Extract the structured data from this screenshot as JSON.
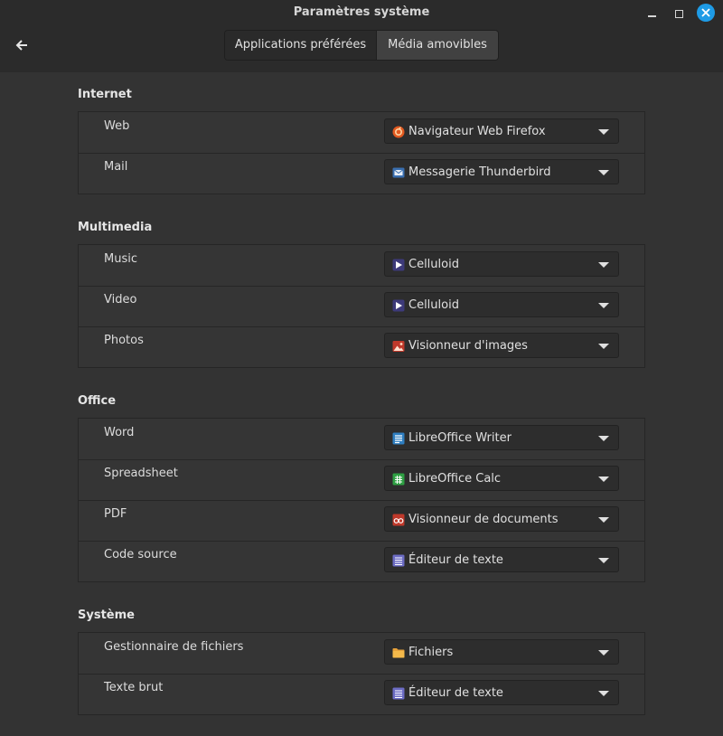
{
  "window": {
    "title": "Paramètres système"
  },
  "tabs": [
    {
      "label": "Applications préférées"
    },
    {
      "label": "Média amovibles"
    }
  ],
  "sections": [
    {
      "title": "Internet",
      "rows": [
        {
          "label": "Web",
          "value": "Navigateur Web Firefox",
          "icon": "firefox-icon"
        },
        {
          "label": "Mail",
          "value": "Messagerie Thunderbird",
          "icon": "thunderbird-icon"
        }
      ]
    },
    {
      "title": "Multimedia",
      "rows": [
        {
          "label": "Music",
          "value": "Celluloid",
          "icon": "celluloid-icon"
        },
        {
          "label": "Video",
          "value": "Celluloid",
          "icon": "celluloid-icon"
        },
        {
          "label": "Photos",
          "value": "Visionneur d'images",
          "icon": "image-viewer-icon"
        }
      ]
    },
    {
      "title": "Office",
      "rows": [
        {
          "label": "Word",
          "value": "LibreOffice Writer",
          "icon": "writer-icon"
        },
        {
          "label": "Spreadsheet",
          "value": "LibreOffice Calc",
          "icon": "calc-icon"
        },
        {
          "label": "PDF",
          "value": "Visionneur de documents",
          "icon": "document-viewer-icon"
        },
        {
          "label": "Code source",
          "value": "Éditeur de texte",
          "icon": "text-editor-icon"
        }
      ]
    },
    {
      "title": "Système",
      "rows": [
        {
          "label": "Gestionnaire de fichiers",
          "value": "Fichiers",
          "icon": "folder-icon"
        },
        {
          "label": "Texte brut",
          "value": "Éditeur de texte",
          "icon": "text-editor-icon"
        }
      ]
    }
  ],
  "colors": {
    "accent": "#1e9be6",
    "background": "#333333",
    "titlebar": "#2b2b2b"
  }
}
